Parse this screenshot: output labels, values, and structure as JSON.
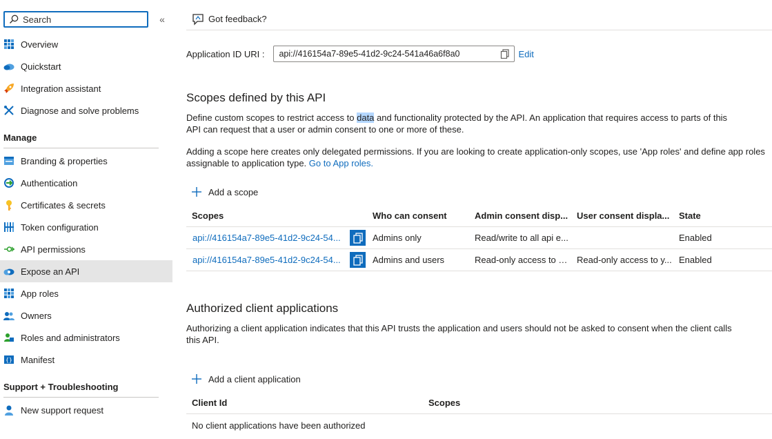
{
  "sidebar": {
    "search_placeholder": "Search",
    "collapse_glyph": "«",
    "items_top": [
      {
        "label": "Overview",
        "icon": "overview-icon"
      },
      {
        "label": "Quickstart",
        "icon": "quickstart-icon"
      },
      {
        "label": "Integration assistant",
        "icon": "rocket-icon"
      },
      {
        "label": "Diagnose and solve problems",
        "icon": "wrench-icon"
      }
    ],
    "manage_title": "Manage",
    "manage_items": [
      {
        "label": "Branding & properties",
        "icon": "branding-icon"
      },
      {
        "label": "Authentication",
        "icon": "authentication-icon"
      },
      {
        "label": "Certificates & secrets",
        "icon": "key-icon"
      },
      {
        "label": "Token configuration",
        "icon": "token-icon"
      },
      {
        "label": "API permissions",
        "icon": "api-permissions-icon"
      },
      {
        "label": "Expose an API",
        "icon": "cloud-icon",
        "active": true
      },
      {
        "label": "App roles",
        "icon": "app-roles-icon"
      },
      {
        "label": "Owners",
        "icon": "owners-icon"
      },
      {
        "label": "Roles and administrators",
        "icon": "roles-admin-icon"
      },
      {
        "label": "Manifest",
        "icon": "manifest-icon"
      }
    ],
    "support_title": "Support + Troubleshooting",
    "support_items": [
      {
        "label": "New support request",
        "icon": "support-icon"
      }
    ]
  },
  "main": {
    "feedback_label": "Got feedback?",
    "app_id_uri_label": "Application ID URI :",
    "app_id_uri_value": "api://416154a7-89e5-41d2-9c24-541a46a6f8a0",
    "edit_label": "Edit",
    "scopes_section": {
      "title": "Scopes defined by this API",
      "para1_a": "Define custom scopes to restrict access to ",
      "para1_highlight": "data",
      "para1_b": " and functionality protected by the API. An application that requires access to parts of this API can request that a user or admin consent to one or more of these.",
      "para2_a": "Adding a scope here creates only delegated permissions. If you are looking to create application-only scopes, use 'App roles' and define app roles assignable to application type. ",
      "para2_link": "Go to App roles.",
      "add_label": "Add a scope",
      "columns": [
        "Scopes",
        "Who can consent",
        "Admin consent disp...",
        "User consent displa...",
        "State"
      ],
      "rows": [
        {
          "scope": "api://416154a7-89e5-41d2-9c24-54...",
          "who": "Admins only",
          "admin": "Read/write to all api e...",
          "user": "",
          "state": "Enabled"
        },
        {
          "scope": "api://416154a7-89e5-41d2-9c24-54...",
          "who": "Admins and users",
          "admin": "Read-only access to E...",
          "user": "Read-only access to y...",
          "state": "Enabled"
        }
      ]
    },
    "clients_section": {
      "title": "Authorized client applications",
      "para": "Authorizing a client application indicates that this API trusts the application and users should not be asked to consent when the client calls this API.",
      "add_label": "Add a client application",
      "columns": [
        "Client Id",
        "Scopes"
      ],
      "empty_text": "No client applications have been authorized"
    }
  },
  "colors": {
    "accent": "#0f6cbd",
    "active_bg": "#e5e5e5",
    "highlight": "#b4d7ff"
  }
}
